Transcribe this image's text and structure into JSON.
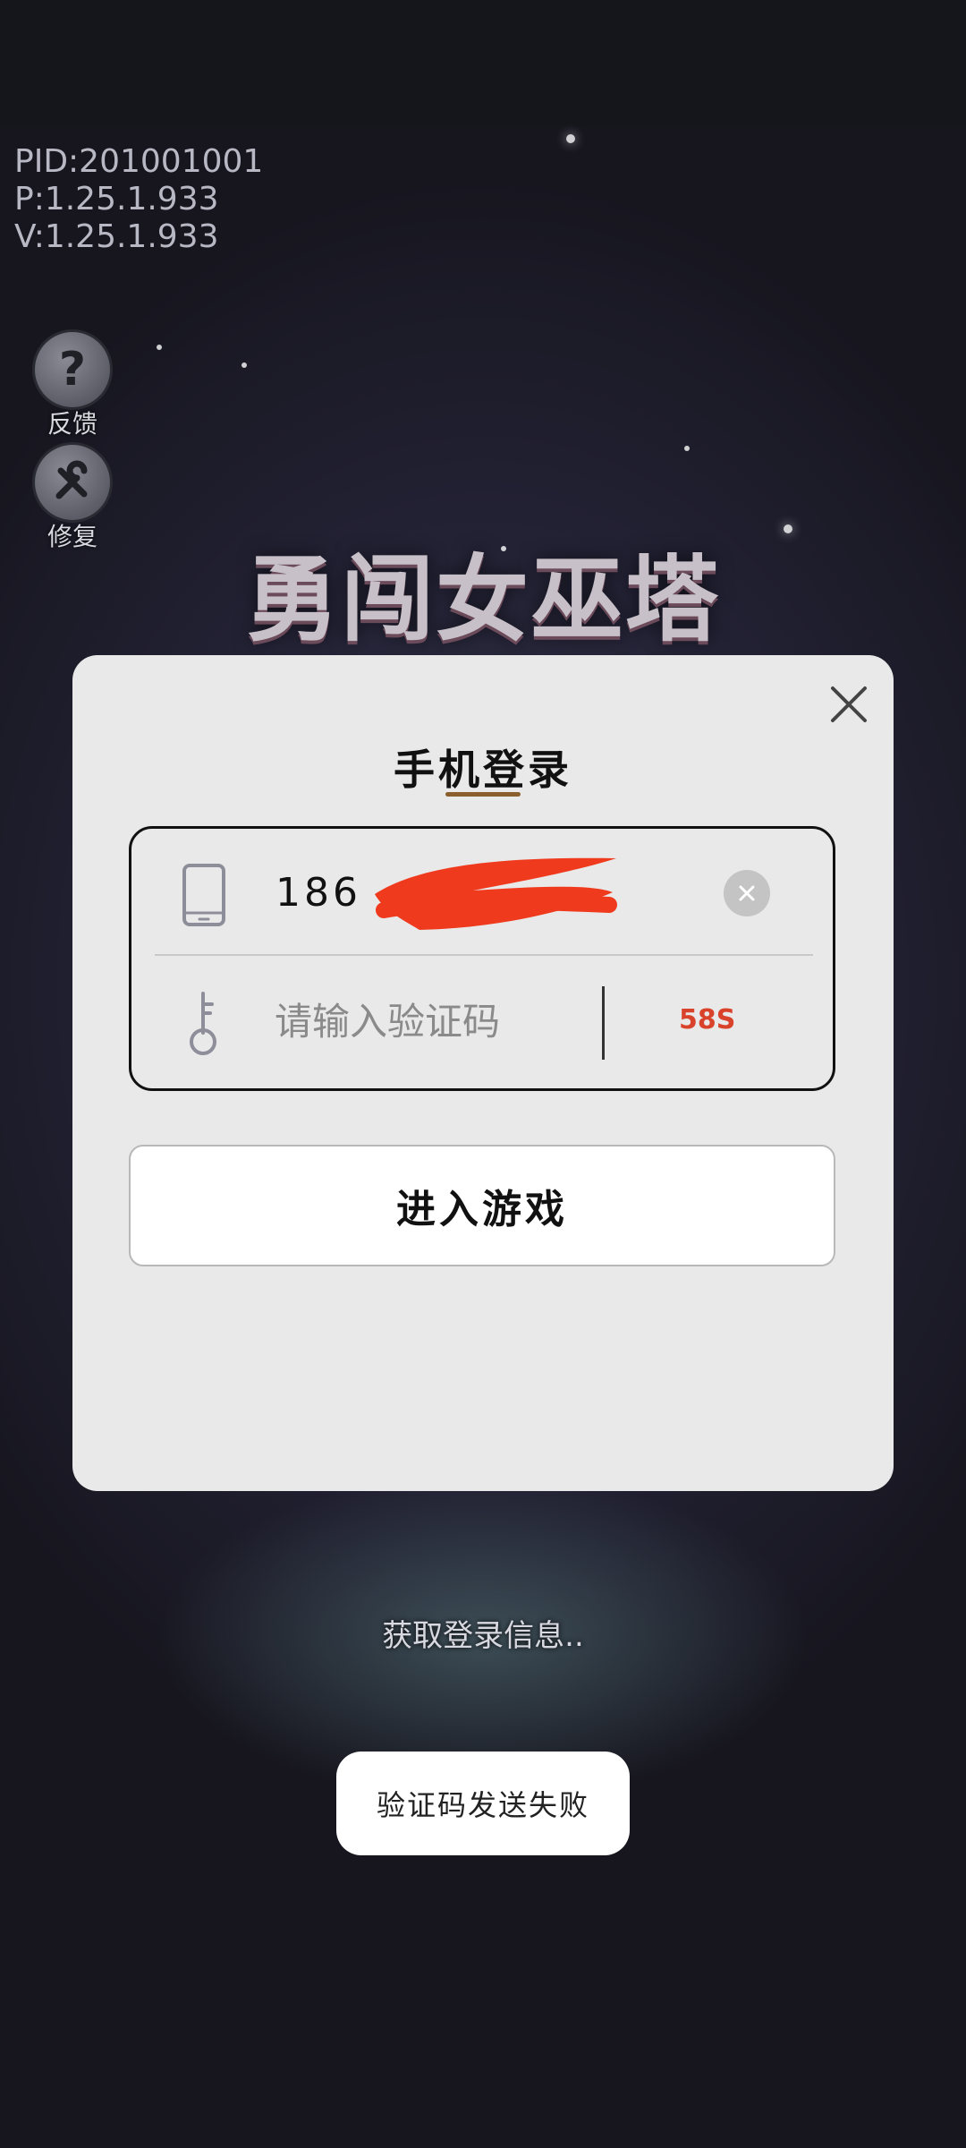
{
  "version_info": {
    "pid": "PID:201001001",
    "p": "P:1.25.1.933",
    "v": "V:1.25.1.933"
  },
  "side_buttons": {
    "feedback": {
      "label": "反馈",
      "icon": "question-icon"
    },
    "repair": {
      "label": "修复",
      "icon": "wrench-icon"
    }
  },
  "game_logo": "勇闯女巫塔",
  "background_status": "获取登录信息..",
  "dialog": {
    "title": "手机登录",
    "phone": {
      "value": "186",
      "icon": "phone-icon",
      "clear_icon": "clear-icon"
    },
    "code": {
      "placeholder": "请输入验证码",
      "icon": "key-icon",
      "countdown": "58S"
    },
    "enter_button": "进入游戏",
    "close_icon": "close-icon"
  },
  "toast": "验证码发送失败",
  "colors": {
    "countdown": "#d9432c",
    "title_underline": "#8b5e2e",
    "redaction": "#f03a1e"
  }
}
